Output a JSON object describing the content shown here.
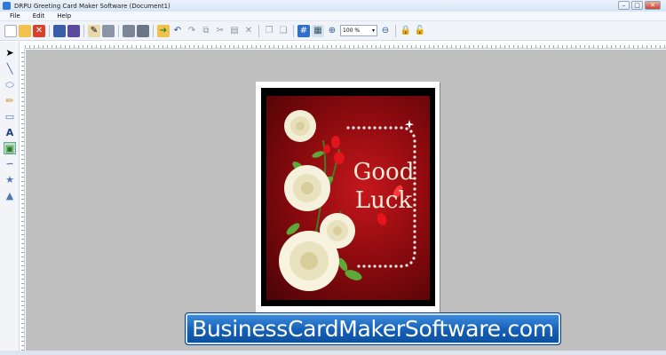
{
  "window": {
    "title": "DRPU Greeting Card Maker Software  (Document1)",
    "controls": [
      "–",
      "□",
      "✕"
    ]
  },
  "menu": {
    "items": [
      "File",
      "Edit",
      "Help"
    ]
  },
  "toolbar": {
    "icons": [
      "new-document-icon",
      "open-folder-icon",
      "close-icon",
      "save-icon",
      "save-all-icon",
      "properties-icon",
      "print-icon",
      "database-icon",
      "database-export-icon",
      "open-icon",
      "undo-icon",
      "redo-icon",
      "copy-format-icon",
      "cut-icon",
      "paste-icon",
      "delete-icon",
      "bring-front-icon",
      "send-back-icon",
      "grid-icon",
      "pattern-icon",
      "zoom-in-icon",
      "zoom-out-icon",
      "lock-icon",
      "unlock-icon"
    ],
    "zoom_value": "100 %"
  },
  "toolbox": {
    "icons": [
      "pointer-icon",
      "line-icon",
      "ellipse-icon",
      "pencil-icon",
      "rectangle-icon",
      "text-icon",
      "image-icon",
      "curve-icon",
      "star-icon",
      "triangle-icon"
    ]
  },
  "card": {
    "line1": "Good",
    "line2": "Luck"
  },
  "banner": {
    "text": "BusinessCardMakerSoftware.com"
  }
}
